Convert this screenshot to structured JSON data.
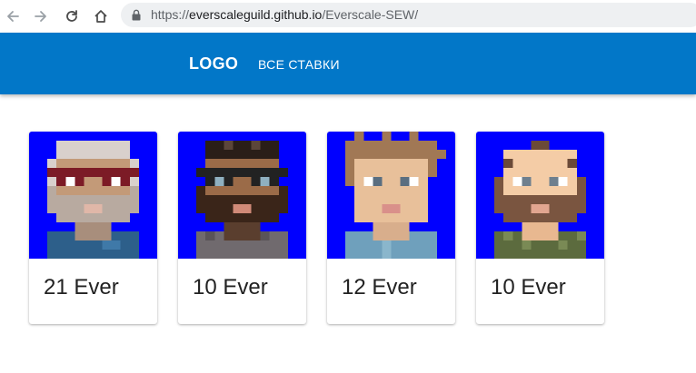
{
  "browser": {
    "url_scheme": "https://",
    "url_host": "everscaleguild.github.io",
    "url_path": "/Everscale-SEW/"
  },
  "header": {
    "logo": "LOGO",
    "nav_link": "ВСЕ СТАВКИ",
    "background_color": "#0277c8"
  },
  "cards": [
    {
      "price": "21 Ever",
      "avatar": "avatar-gray-hair-red-glasses"
    },
    {
      "price": "10 Ever",
      "avatar": "avatar-dark-skin-glasses-beard"
    },
    {
      "price": "12 Ever",
      "avatar": "avatar-curly-hair"
    },
    {
      "price": "10 Ever",
      "avatar": "avatar-bald-beard-plaid"
    }
  ],
  "colors": {
    "avatar_background": "#0000ff"
  }
}
